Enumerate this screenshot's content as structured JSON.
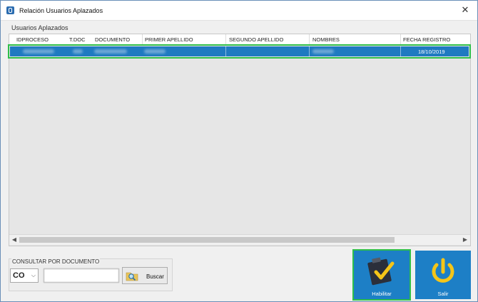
{
  "window": {
    "title": "Relación Usuarios Aplazados",
    "close_label": "✕"
  },
  "group": {
    "label": "Usuarios Aplazados"
  },
  "grid": {
    "columns": [
      "IDPROCESO",
      "T.DOC",
      "DOCUMENTO",
      "PRIMER APELLIDO",
      "SEGUNDO APELLIDO",
      "NOMBRES",
      "FECHA REGISTRO"
    ],
    "rows": [
      {
        "fecha_registro": "18/10/2019"
      }
    ]
  },
  "consult": {
    "label": "CONSULTAR POR DOCUMENTO",
    "doc_type": "CO",
    "search_button": "Buscar"
  },
  "actions": {
    "habilitar": "Habilitar",
    "salir": "Salir"
  },
  "colors": {
    "accent": "#1d7fc6",
    "selection": "#1f7ac1",
    "highlight": "#2fbf4a",
    "check": "#f5c518"
  },
  "icons": {
    "app": "app-icon",
    "close": "close-icon",
    "search": "search-folder-icon",
    "habilitar": "clipboard-check-icon",
    "salir": "power-icon"
  }
}
